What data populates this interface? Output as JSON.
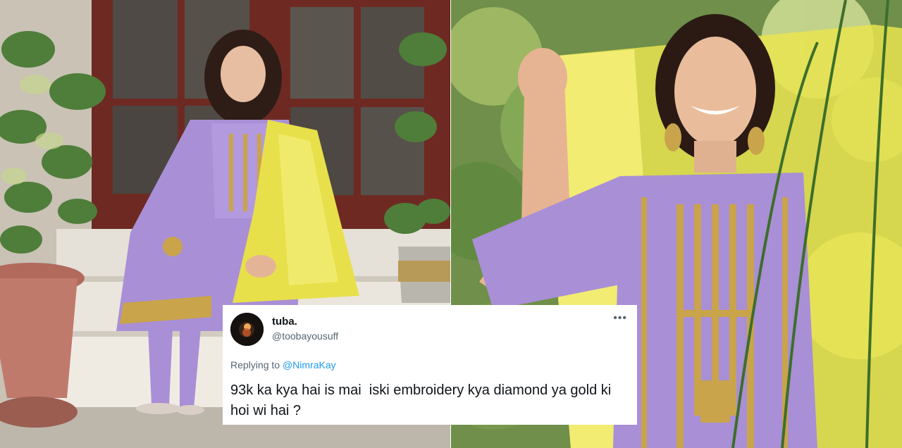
{
  "tweet": {
    "display_name": "tuba.",
    "handle": "@toobayousuff",
    "more_icon": "more-horizontal-icon",
    "replying_prefix": "Replying to ",
    "replying_to": "@NimraKay",
    "text": "93k ka kya hai is mai  iski embroidery kya diamond ya gold ki hoi wi hai ?"
  },
  "photos": {
    "left": "model-in-lilac-suit-seated-on-steps",
    "right": "model-holding-yellow-dupatta-outdoors"
  },
  "colors": {
    "lilac": "#a98fd6",
    "dupatta_yellow": "#e8e04a",
    "embroidery_gold": "#c9a44a",
    "door_brown": "#6e2a22",
    "link_blue": "#1d9bf0"
  }
}
